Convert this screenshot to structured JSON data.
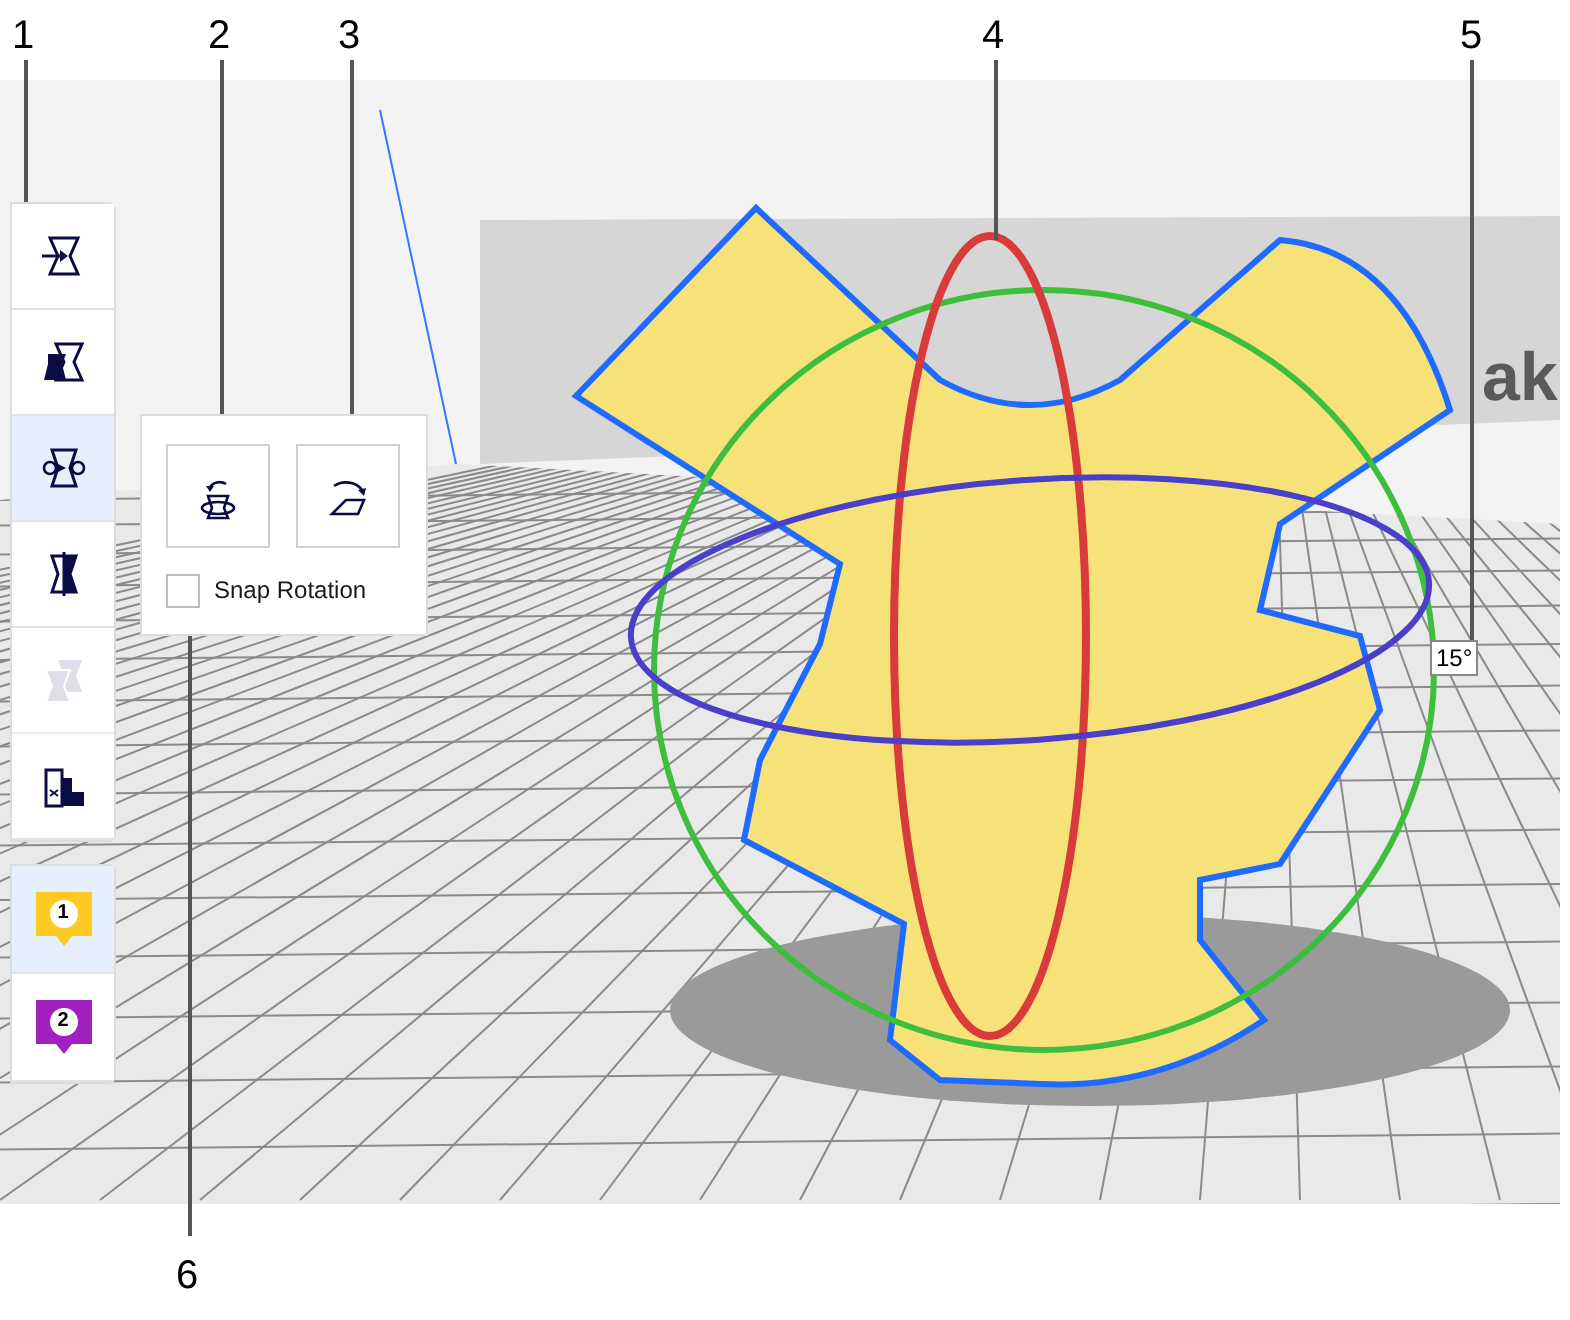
{
  "callouts": [
    {
      "label": "1"
    },
    {
      "label": "2"
    },
    {
      "label": "3"
    },
    {
      "label": "4"
    },
    {
      "label": "5"
    },
    {
      "label": "6"
    }
  ],
  "toolbar": {
    "tools": [
      {
        "kind": "move",
        "selected": false,
        "disabled": false
      },
      {
        "kind": "scale",
        "selected": false,
        "disabled": false
      },
      {
        "kind": "rotate",
        "selected": true,
        "disabled": false
      },
      {
        "kind": "mirror",
        "selected": false,
        "disabled": false
      },
      {
        "kind": "per_model",
        "selected": false,
        "disabled": true
      },
      {
        "kind": "support_blocker",
        "selected": false,
        "disabled": false
      }
    ],
    "extruders": [
      {
        "label": "1",
        "color": "#ffc924",
        "selected": true
      },
      {
        "label": "2",
        "color": "#a020c0",
        "selected": false
      }
    ]
  },
  "rotate_panel": {
    "buttons": [
      {
        "kind": "reset"
      },
      {
        "kind": "lay_flat"
      }
    ],
    "snap_rotation": {
      "label": "Snap Rotation",
      "checked": false
    }
  },
  "viewport": {
    "back_plate_text": "ak",
    "angle_label": "15°"
  }
}
